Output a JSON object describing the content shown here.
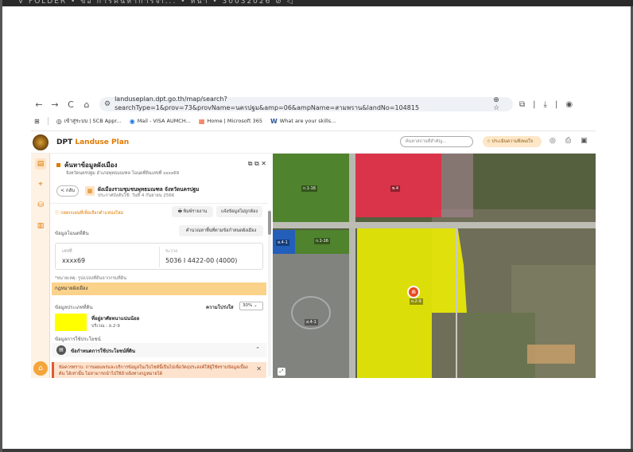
{
  "window": {
    "top_title": "V FOLDER • ข้อ การค้นหาการจำ...  • หน้า  • 30032026 ⊘ ◁"
  },
  "browser": {
    "nav": {
      "back": "←",
      "forward": "→",
      "reload": "C",
      "home": "⌂"
    },
    "url": "landuseplan.dpt.go.th/map/search?searchType=1&prov=73&provName=นครปฐม&amp=06&ampName=สามพราน&landNo=104815",
    "url_icons": "⊕  ☆",
    "right_icons": [
      "⧉",
      "|",
      "⤓",
      "|",
      "◉"
    ],
    "bookmarks": [
      {
        "icon": "⊞",
        "label": ""
      },
      {
        "icon": "◎",
        "label": "เข้าสู่ระบบ | SCB Appr..."
      },
      {
        "icon": "◉",
        "label": "Mail - VISA AUMCH..."
      },
      {
        "icon": "▦",
        "label": "Home | Microsoft 365"
      },
      {
        "icon": "W",
        "label": "What are your skills..."
      }
    ]
  },
  "app": {
    "brand_prefix": "DPT",
    "brand_suffix": "Landuse Plan",
    "search_placeholder": "ค้นหาสถานที่สำคัญ...",
    "eval_label": "☆ ประเมินความพึงพอใจ",
    "header_icons": [
      "◎",
      "⎙",
      "▣"
    ],
    "rail_icons": [
      "▤",
      "⌖",
      "⛁",
      "▥"
    ],
    "rail_home": "⌂"
  },
  "panel": {
    "title": "ค้นหาข้อมูลผังเมือง",
    "subtitle": "จังหวัดนครปฐม อำเภอพุทธมณฑล โฉนดที่ดินเลขที่ xxxx69",
    "window_icons": "⧉ ⧉ ✕",
    "back_label": "< กลับ",
    "plan_name": "ผังเมืองรวมชุมชนพุทธมณฑล จังหวัดนครปฐม",
    "plan_date": "ประกาศบังคับใช้: วันที่ 4 กันยายน 2566",
    "warning": "ⓘ กดตกแผนที่เพื่อเลือกตำแหน่งใหม่",
    "print_label": "🖶 พิมพ์รายงาน",
    "report_label": "แจ้งข้อมูลไม่ถูกต้อง",
    "land_section": "ข้อมูลโฉนดที่ดิน",
    "calc_label": "คำนวณหาพื้นที่ตามข้อกำหนดผังเมือง",
    "land_no_key": "เลขที่",
    "land_no_val": "xxxx69",
    "sheet_key": "ระวาง",
    "sheet_val": "5036 I 4422-00 (4000)",
    "note": "*หมายเหตุ: รูปแปลงที่ดินจากกรมที่ดิน",
    "law_label": "กฎหมายผังเมือง",
    "zone_section": "ข้อมูลประเภทที่ดิน",
    "opacity_label": "ความโปร่งใส",
    "opacity_value": "30%  ⌄",
    "zone_name": "ที่อยู่อาศัยหนาแน่นน้อย",
    "zone_code": "บริเวณ : ย.2-9",
    "use_section": "ข้อมูลการใช้ประโยชน์",
    "req_label": "ข้อกำหนดการใช้ประโยชน์ที่ดิน",
    "req_icon": "▤",
    "req_chevron": "⌃",
    "disclaimer": "ข้อควรทราบ: การเผยแพร่และบริการข้อมูลในเว็บไซต์นี้เป็นไปเพื่อวัตถุประสงค์ให้ผู้ใช้ทราบข้อมูลเบื้องต้น ได้เท่านั้น ไม่สามารถนำไปใช้อ้างอิงทางกฎหมายได้",
    "disclaimer_close": "✕"
  },
  "map": {
    "zone_labels": [
      "ก.1-16",
      "พ.4",
      "ก.1-16",
      "ส.4-1",
      "ย.2-9",
      "ส.4-1"
    ],
    "pin_icon": "⋒",
    "pin_label": "ย.2-9",
    "colors": {
      "commercial": "#e8304a",
      "residential": "#f4f400",
      "agri": "#4f8a2a",
      "public": "#8a8a8a",
      "gov": "#1e5fc8"
    }
  }
}
